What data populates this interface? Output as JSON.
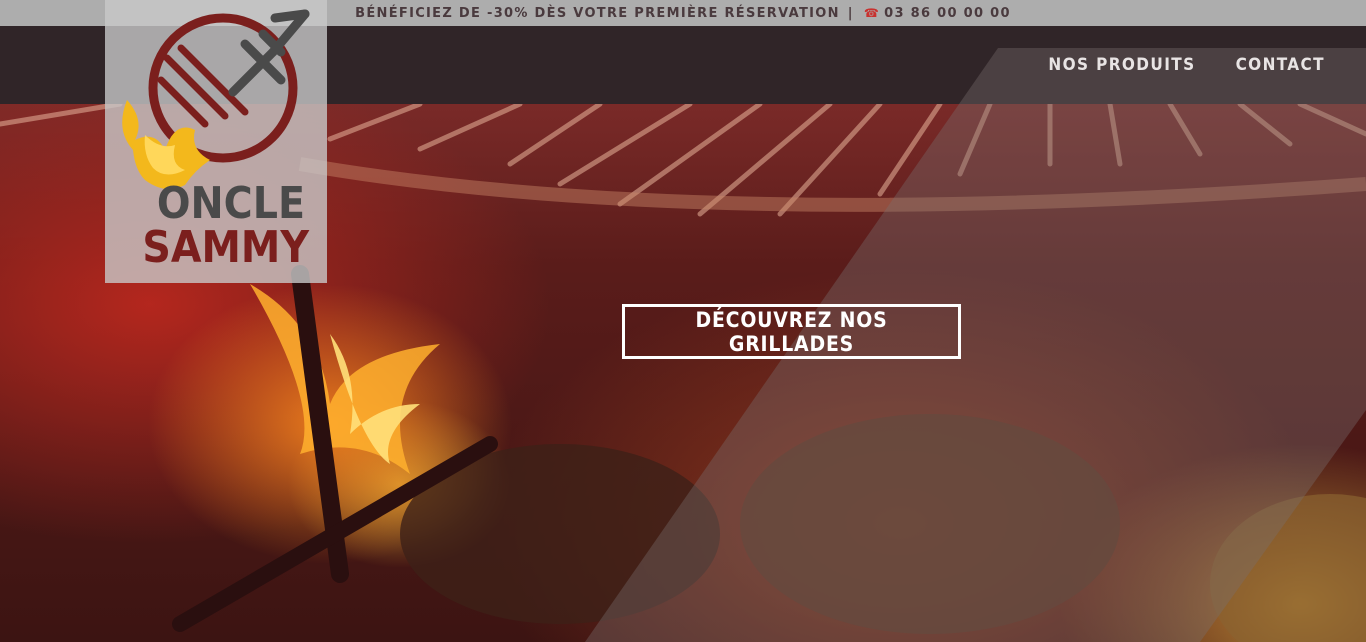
{
  "announcement": {
    "text": "BÉNÉFICIEZ DE -30% DÈS VOTRE PREMIÈRE RÉSERVATION",
    "separator": "|",
    "phone_icon": "phone-icon",
    "phone": "03 86 00 00 00"
  },
  "logo": {
    "line1": "ONCLE",
    "line2": "SAMMY",
    "emblem": "fork-plate-flame-icon"
  },
  "nav": {
    "items": [
      {
        "label": "NOS PRODUITS"
      },
      {
        "label": "CONTACT"
      }
    ]
  },
  "hero": {
    "cta_label": "DÉCOUVREZ NOS GRILLADES"
  },
  "colors": {
    "topbar_bg": "#adadad",
    "navbar_bg": "#302528",
    "logo_dark_red": "#7b1f1d",
    "logo_gray": "#4a4a4a",
    "flame_yellow": "#f3b81c",
    "phone_red": "#c8312f"
  }
}
